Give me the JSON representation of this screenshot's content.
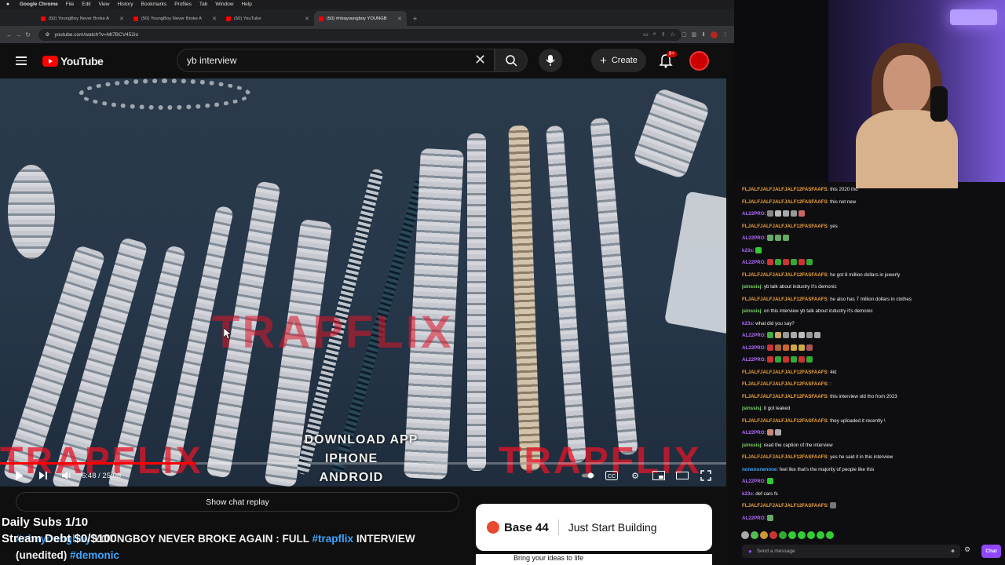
{
  "menubar": {
    "app": "Google Chrome",
    "items": [
      "File",
      "Edit",
      "View",
      "History",
      "Bookmarks",
      "Profiles",
      "Tab",
      "Window",
      "Help"
    ]
  },
  "tabs": [
    {
      "title": "(50) YoungBoy Never Broke A",
      "active": false
    },
    {
      "title": "(50) YoungBoy Never Broke A",
      "active": false
    },
    {
      "title": "(50) YouTube",
      "active": false
    },
    {
      "title": "(50) #nbayoungboy YOUNGB",
      "active": true
    }
  ],
  "address": {
    "url": "youtube.com/watch?v=Mt7BCV452io"
  },
  "youtube": {
    "logo_text": "YouTube",
    "search_value": "yb interview",
    "create_label": "Create",
    "notif_count": "9+"
  },
  "video": {
    "watermark": "TRAPFLIX",
    "download_lines": [
      "DOWNLOAD APP",
      "IPHONE",
      "ANDROID"
    ],
    "timecode": "6:48 / 25:08",
    "progress_fraction": 0.27
  },
  "below": {
    "chat_replay_label": "Show chat replay",
    "overlay_line1": "Daily Subs 1/10",
    "overlay_line2": "Stream Debt $0/$100",
    "title_hashtag1": "#nbayoungboy",
    "title_main": " YOUNGBOY NEVER BROKE AGAIN : FULL ",
    "title_hashtag2": "#trapflix",
    "title_end": " INTERVIEW",
    "title_line2_prefix": "(unedited) ",
    "title_hashtag3": "#demonic"
  },
  "ad": {
    "brand": "Base 44",
    "slogan": "Just Start Building",
    "sub": "Bring your ideas to life"
  },
  "chat": {
    "messages": [
      {
        "user": "FLJALFJALFJALFJALF12FASFAAFS",
        "color": "#f2a33a",
        "text": "this 2020 tho"
      },
      {
        "user": "FLJALFJALFJALFJALF12FASFAAFS",
        "color": "#f2a33a",
        "text": "this not new"
      },
      {
        "user": "AL22PRO",
        "color": "#b36bff",
        "text": "",
        "emotes": [
          "#888",
          "#bbb",
          "#aaa",
          "#999",
          "#c66"
        ]
      },
      {
        "user": "FLJALFJALFJALFJALF12FASFAAFS",
        "color": "#f2a33a",
        "text": "yes"
      },
      {
        "user": "AL22PRO",
        "color": "#b36bff",
        "text": "",
        "emotes": [
          "#6a6",
          "#6a6",
          "#6a6"
        ]
      },
      {
        "user": "k23s",
        "color": "#b36bff",
        "text": "",
        "emotes": [
          "#3c3"
        ]
      },
      {
        "user": "AL22PRO",
        "color": "#b36bff",
        "text": "",
        "emotes": [
          "#c33",
          "#3a3",
          "#c33",
          "#3a3",
          "#c33",
          "#3a3"
        ]
      },
      {
        "user": "FLJALFJALFJALFJALF12FASFAAFS",
        "color": "#f2a33a",
        "text": "he got 8 million dollars in jewerly"
      },
      {
        "user": "jsinssisj",
        "color": "#7fd36b",
        "text": "yb talk about industry it's demonic"
      },
      {
        "user": "FLJALFJALFJALFJALF12FASFAAFS",
        "color": "#f2a33a",
        "text": "he also has 7 million dollars in clothes"
      },
      {
        "user": "jsinssisj",
        "color": "#7fd36b",
        "text": "on this interview yb talk about industry it's demonic"
      },
      {
        "user": "k23s",
        "color": "#b36bff",
        "text": "what did you say?"
      },
      {
        "user": "AL22PRO",
        "color": "#b36bff",
        "text": "",
        "emotes": [
          "#4a4",
          "#ca6",
          "#999",
          "#aaa",
          "#bbb",
          "#999",
          "#aaa"
        ]
      },
      {
        "user": "AL22PRO",
        "color": "#b36bff",
        "text": "",
        "emotes": [
          "#c33",
          "#a63",
          "#c63",
          "#ca4",
          "#ca4",
          "#a55"
        ]
      },
      {
        "user": "AL22PRO",
        "color": "#b36bff",
        "text": "",
        "emotes": [
          "#c33",
          "#3a3",
          "#c33",
          "#3a3",
          "#c33",
          "#3a3"
        ]
      },
      {
        "user": "FLJALFJALFJALFJALF12FASFAAFS",
        "color": "#f2a33a",
        "text": "4kt"
      },
      {
        "user": "FLJALFJALFJALFJALF12FASFAAFS",
        "color": "#f2a33a",
        "text": ":"
      },
      {
        "user": "FLJALFJALFJALFJALF12FASFAAFS",
        "color": "#f2a33a",
        "text": "this interview old tho from 2023"
      },
      {
        "user": "jsinssisj",
        "color": "#7fd36b",
        "text": "it got leaked"
      },
      {
        "user": "FLJALFJALFJALFJALF12FASFAAFS",
        "color": "#f2a33a",
        "text": "they uploaded it recently \\"
      },
      {
        "user": "AL22PRO",
        "color": "#b36bff",
        "text": "",
        "emotes": [
          "#c87",
          "#aaa"
        ]
      },
      {
        "user": "jsinssisj",
        "color": "#7fd36b",
        "text": "read the caption of the interview"
      },
      {
        "user": "FLJALFJALFJALFJALF12FASFAAFS",
        "color": "#f2a33a",
        "text": "yes he said it in this interview"
      },
      {
        "user": "nonenonenone",
        "color": "#3ea6ff",
        "text": "feel like that's the majority of people like this"
      },
      {
        "user": "AL22PRO",
        "color": "#b36bff",
        "text": "",
        "emotes": [
          "#3c3"
        ]
      },
      {
        "user": "k23s",
        "color": "#b36bff",
        "text": "def cars fs"
      },
      {
        "user": "FLJALFJALFJALFJALF12FASFAAFS",
        "color": "#f2a33a",
        "text": "",
        "emotes": [
          "#777"
        ]
      },
      {
        "user": "AL22PRO",
        "color": "#b36bff",
        "text": "",
        "emotes": [
          "#6a6"
        ]
      }
    ],
    "emotebar_colors": [
      "#aaa",
      "#5b5",
      "#c93",
      "#c33",
      "#3a3",
      "#3c3",
      "#3c3",
      "#3c3",
      "#3c3",
      "#3c3"
    ],
    "input_placeholder": "Send a message",
    "send_label": "Chat"
  }
}
